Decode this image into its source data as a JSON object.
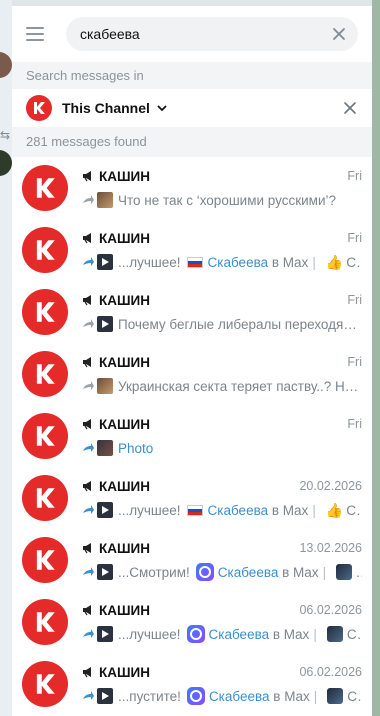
{
  "search": {
    "value": "скабеева"
  },
  "scope": {
    "section_label": "Search messages in",
    "channel_name": "This Channel"
  },
  "results": {
    "count_label": "281 messages found"
  },
  "items": [
    {
      "name": "КАШИН",
      "date": "Fri",
      "thumb": "photo",
      "text": "Что не так с ‘хорошими русскими’?"
    },
    {
      "name": "КАШИН",
      "date": "Fri",
      "thumb": "video",
      "prefix": "...лучшее!",
      "link": "Скабеева",
      "mid": "в Max",
      "tail": "С..."
    },
    {
      "name": "КАШИН",
      "date": "Fri",
      "thumb": "video",
      "text": "Почему беглые либералы переходят ..."
    },
    {
      "name": "КАШИН",
      "date": "Fri",
      "thumb": "photo",
      "text": "Украинская секта теряет паству..?  Не..."
    },
    {
      "name": "КАШИН",
      "date": "Fri",
      "thumb": "multi",
      "link_text": "Photo"
    },
    {
      "name": "КАШИН",
      "date": "20.02.2026",
      "thumb": "video",
      "prefix": "...лучшее!",
      "link": "Скабеева",
      "mid": "в Max",
      "tail": "С..."
    },
    {
      "name": "КАШИН",
      "date": "13.02.2026",
      "thumb": "video",
      "prefix": "...Смотрим!",
      "link": "Скабеева",
      "mid": "в Max",
      "tail": "..."
    },
    {
      "name": "КАШИН",
      "date": "06.02.2026",
      "thumb": "video",
      "prefix": "...лучшее!",
      "link": "Скабеева",
      "mid": "в Max",
      "tail": "С..."
    },
    {
      "name": "КАШИН",
      "date": "06.02.2026",
      "thumb": "video",
      "prefix": "...пустите!",
      "link": "Скабеева",
      "mid": "в Max",
      "tail": "С..."
    }
  ]
}
